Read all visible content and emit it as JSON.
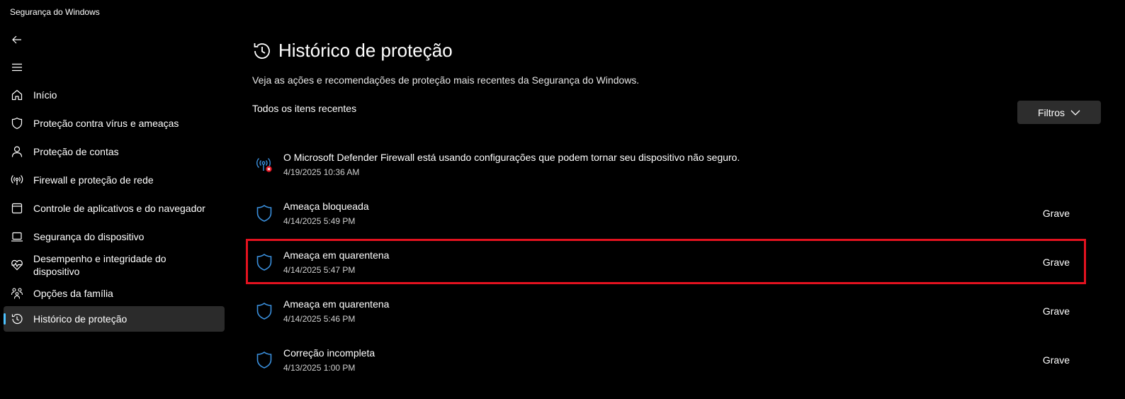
{
  "window": {
    "title": "Segurança do Windows"
  },
  "sidebar": {
    "back_icon": "back-arrow-icon",
    "menu_icon": "hamburger-menu-icon",
    "items": [
      {
        "label": "Início",
        "icon": "home-icon"
      },
      {
        "label": "Proteção contra vírus e ameaças",
        "icon": "shield-icon"
      },
      {
        "label": "Proteção de contas",
        "icon": "person-icon"
      },
      {
        "label": "Firewall e proteção de rede",
        "icon": "antenna-icon"
      },
      {
        "label": "Controle de aplicativos e do navegador",
        "icon": "app-window-icon"
      },
      {
        "label": "Segurança do dispositivo",
        "icon": "laptop-icon"
      },
      {
        "label": "Desempenho e integridade do dispositivo",
        "icon": "heart-pulse-icon"
      },
      {
        "label": "Opções da família",
        "icon": "family-icon"
      },
      {
        "label": "Histórico de proteção",
        "icon": "history-icon",
        "active": true
      }
    ]
  },
  "main": {
    "title": "Histórico de proteção",
    "description": "Veja as ações e recomendações de proteção mais recentes da Segurança do Windows.",
    "section_label": "Todos os itens recentes",
    "filters_label": "Filtros",
    "accent_color": "#4cc2ff",
    "shield_color": "#3a8fdc",
    "highlight_color": "#e3121f",
    "history": [
      {
        "title": "O Microsoft Defender Firewall está usando configurações que podem tornar seu dispositivo não seguro.",
        "time": "4/19/2025 10:36 AM",
        "severity": "",
        "icon": "firewall-warning-icon"
      },
      {
        "title": "Ameaça bloqueada",
        "time": "4/14/2025 5:49 PM",
        "severity": "Grave",
        "icon": "shield-icon"
      },
      {
        "title": "Ameaça em quarentena",
        "time": "4/14/2025 5:47 PM",
        "severity": "Grave",
        "icon": "shield-icon",
        "highlighted": true
      },
      {
        "title": "Ameaça em quarentena",
        "time": "4/14/2025 5:46 PM",
        "severity": "Grave",
        "icon": "shield-icon"
      },
      {
        "title": "Correção incompleta",
        "time": "4/13/2025 1:00 PM",
        "severity": "Grave",
        "icon": "shield-icon"
      }
    ]
  }
}
